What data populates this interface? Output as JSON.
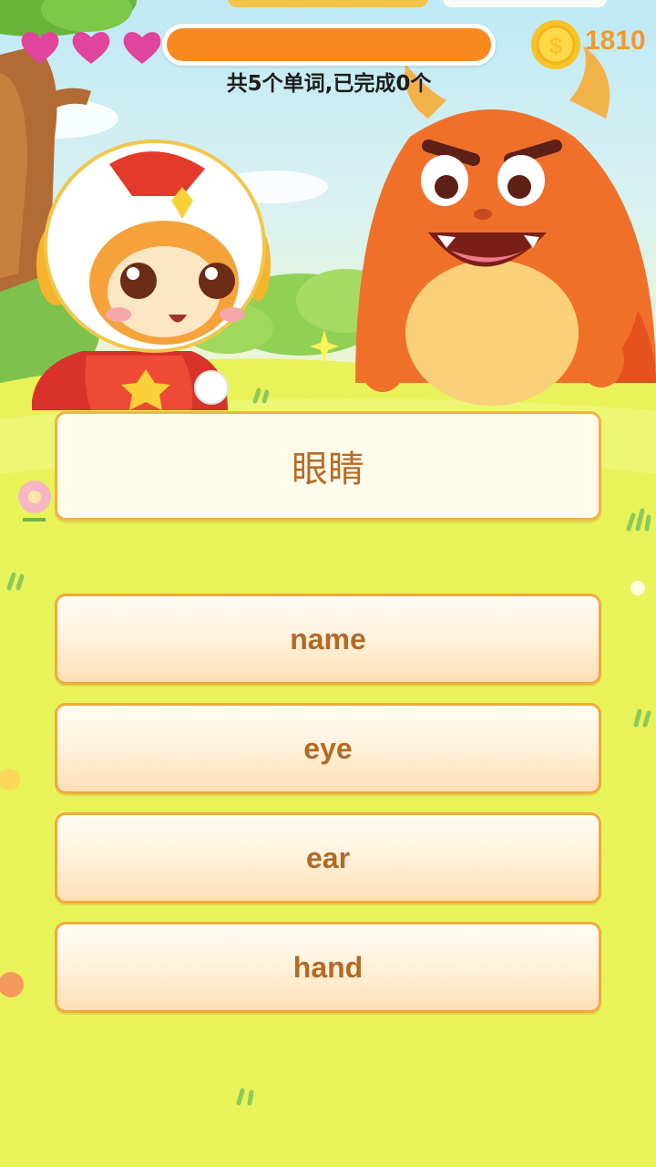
{
  "hud": {
    "lives": 3,
    "progress_fraction": 1.0,
    "progress_text": "共5个单词,已完成0个",
    "coin_count": "1810"
  },
  "question": {
    "word": "眼睛"
  },
  "options": [
    {
      "label": "name"
    },
    {
      "label": "eye"
    },
    {
      "label": "ear"
    },
    {
      "label": "hand"
    }
  ],
  "colors": {
    "heart": "#e0449c",
    "progress": "#f7891f",
    "coin": "#f7c326",
    "accent_text": "#b26a25"
  },
  "icons": {
    "life": "heart-icon",
    "currency": "coin-icon"
  }
}
